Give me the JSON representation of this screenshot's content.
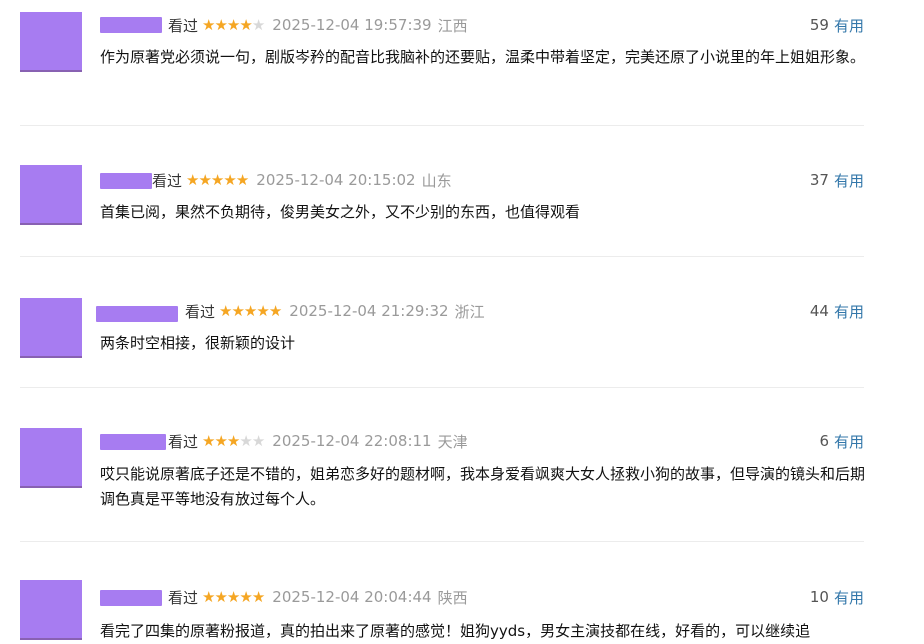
{
  "comments": [
    {
      "watched": "看过",
      "rating": 4,
      "time": "2025-12-04 19:57:39",
      "region": "江西",
      "votes": "59",
      "useful": "有用",
      "text": "作为原著党必须说一句，剧版岑矜的配音比我脑补的还要贴，温柔中带着坚定，完美还原了小说里的年上姐姐形象。"
    },
    {
      "watched": "看过",
      "rating": 5,
      "time": "2025-12-04 20:15:02",
      "region": "山东",
      "votes": "37",
      "useful": "有用",
      "text": "首集已阅，果然不负期待，俊男美女之外，又不少别的东西，也值得观看"
    },
    {
      "watched": "看过",
      "rating": 5,
      "time": "2025-12-04 21:29:32",
      "region": "浙江",
      "votes": "44",
      "useful": "有用",
      "text": "两条时空相接，很新颖的设计"
    },
    {
      "watched": "看过",
      "rating": 3,
      "time": "2025-12-04 22:08:11",
      "region": "天津",
      "votes": "6",
      "useful": "有用",
      "text": "哎只能说原著底子还是不错的，姐弟恋多好的题材啊，我本身爱看飒爽大女人拯救小狗的故事，但导演的镜头和后期调色真是平等地没有放过每个人。"
    },
    {
      "watched": "看过",
      "rating": 5,
      "time": "2025-12-04 20:04:44",
      "region": "陕西",
      "votes": "10",
      "useful": "有用",
      "text": "看完了四集的原著粉报道，真的拍出来了原著的感觉！姐狗yyds，男女主演技都在线，好看的，可以继续追"
    }
  ]
}
